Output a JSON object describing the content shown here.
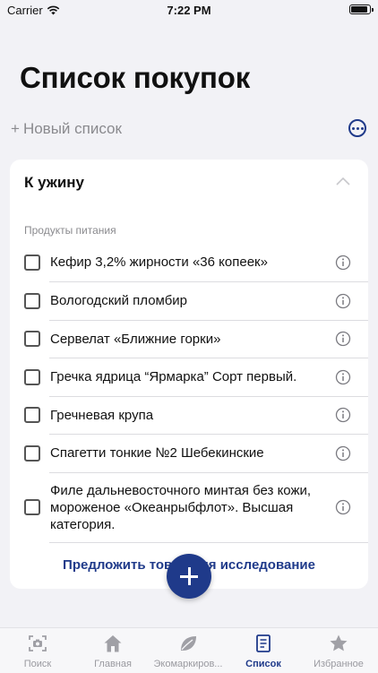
{
  "status": {
    "carrier": "Carrier",
    "time": "7:22 PM"
  },
  "page": {
    "title": "Список покупок"
  },
  "new_list": {
    "plus": "+",
    "label": "Новый список"
  },
  "list": {
    "title": "К ужину",
    "section": "Продукты питания",
    "items": [
      {
        "label": "Кефир 3,2% жирности «36 копеек»"
      },
      {
        "label": "Вологодский пломбир"
      },
      {
        "label": "Сервелат «Ближние горки»"
      },
      {
        "label": "Гречка ядрица “Ярмарка” Сорт первый."
      },
      {
        "label": "Гречневая крупа"
      },
      {
        "label": "Спагетти тонкие №2 Шебекинские"
      },
      {
        "label": "Филе дальневосточного минтая без кожи, мороженое «Океанрыбфлот». Высшая категория."
      }
    ],
    "suggest": "Предложить товар для исследование"
  },
  "tabs": [
    {
      "label": "Поиск",
      "icon": "camera-scan-icon"
    },
    {
      "label": "Главная",
      "icon": "home-icon"
    },
    {
      "label": "Экомаркиров...",
      "icon": "leaf-icon"
    },
    {
      "label": "Список",
      "icon": "list-doc-icon",
      "active": true
    },
    {
      "label": "Избранное",
      "icon": "star-icon"
    }
  ],
  "colors": {
    "accent": "#1f3a8a",
    "background": "#f2f2f6",
    "muted": "#8a8a8e"
  }
}
